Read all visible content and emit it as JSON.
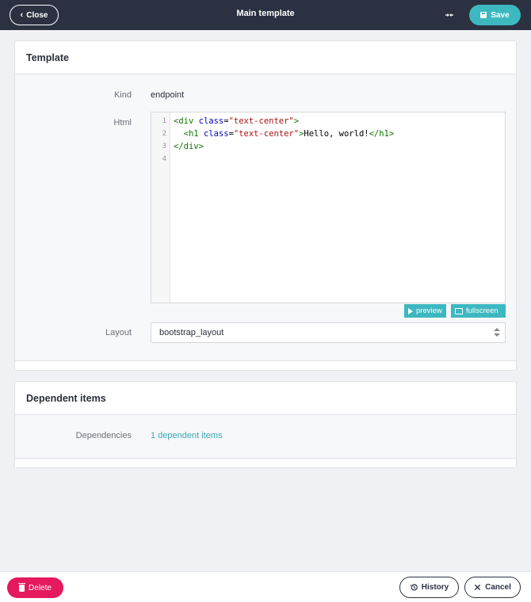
{
  "header": {
    "close_label": "Close",
    "title": "Main template",
    "save_label": "Save"
  },
  "template_panel": {
    "heading": "Template",
    "kind_label": "Kind",
    "kind_value": "endpoint",
    "html_label": "Html",
    "code_lines": [
      "<div class=\"text-center\">",
      "  <h1 class=\"text-center\">Hello, world!</h1>",
      "</div>",
      ""
    ],
    "line_numbers": [
      "1",
      "2",
      "3",
      "4"
    ],
    "preview_label": "preview",
    "fullscreen_label": "fullscreen",
    "layout_label": "Layout",
    "layout_value": "bootstrap_layout"
  },
  "dependent_panel": {
    "heading": "Dependent items",
    "dependencies_label": "Dependencies",
    "dependencies_link": "1 dependent items"
  },
  "footer": {
    "delete_label": "Delete",
    "history_label": "History",
    "cancel_label": "Cancel"
  },
  "colors": {
    "topbar": "#2b3141",
    "accent": "#3db8c0",
    "danger": "#e5195d"
  },
  "icons": {
    "close": "chevron-left-icon",
    "compress": "compress-icon",
    "save": "floppy-disk-icon",
    "preview": "play-icon",
    "fullscreen": "image-icon",
    "select": "sort-arrows-icon",
    "delete": "trash-icon",
    "history": "history-icon",
    "cancel": "x-icon"
  }
}
